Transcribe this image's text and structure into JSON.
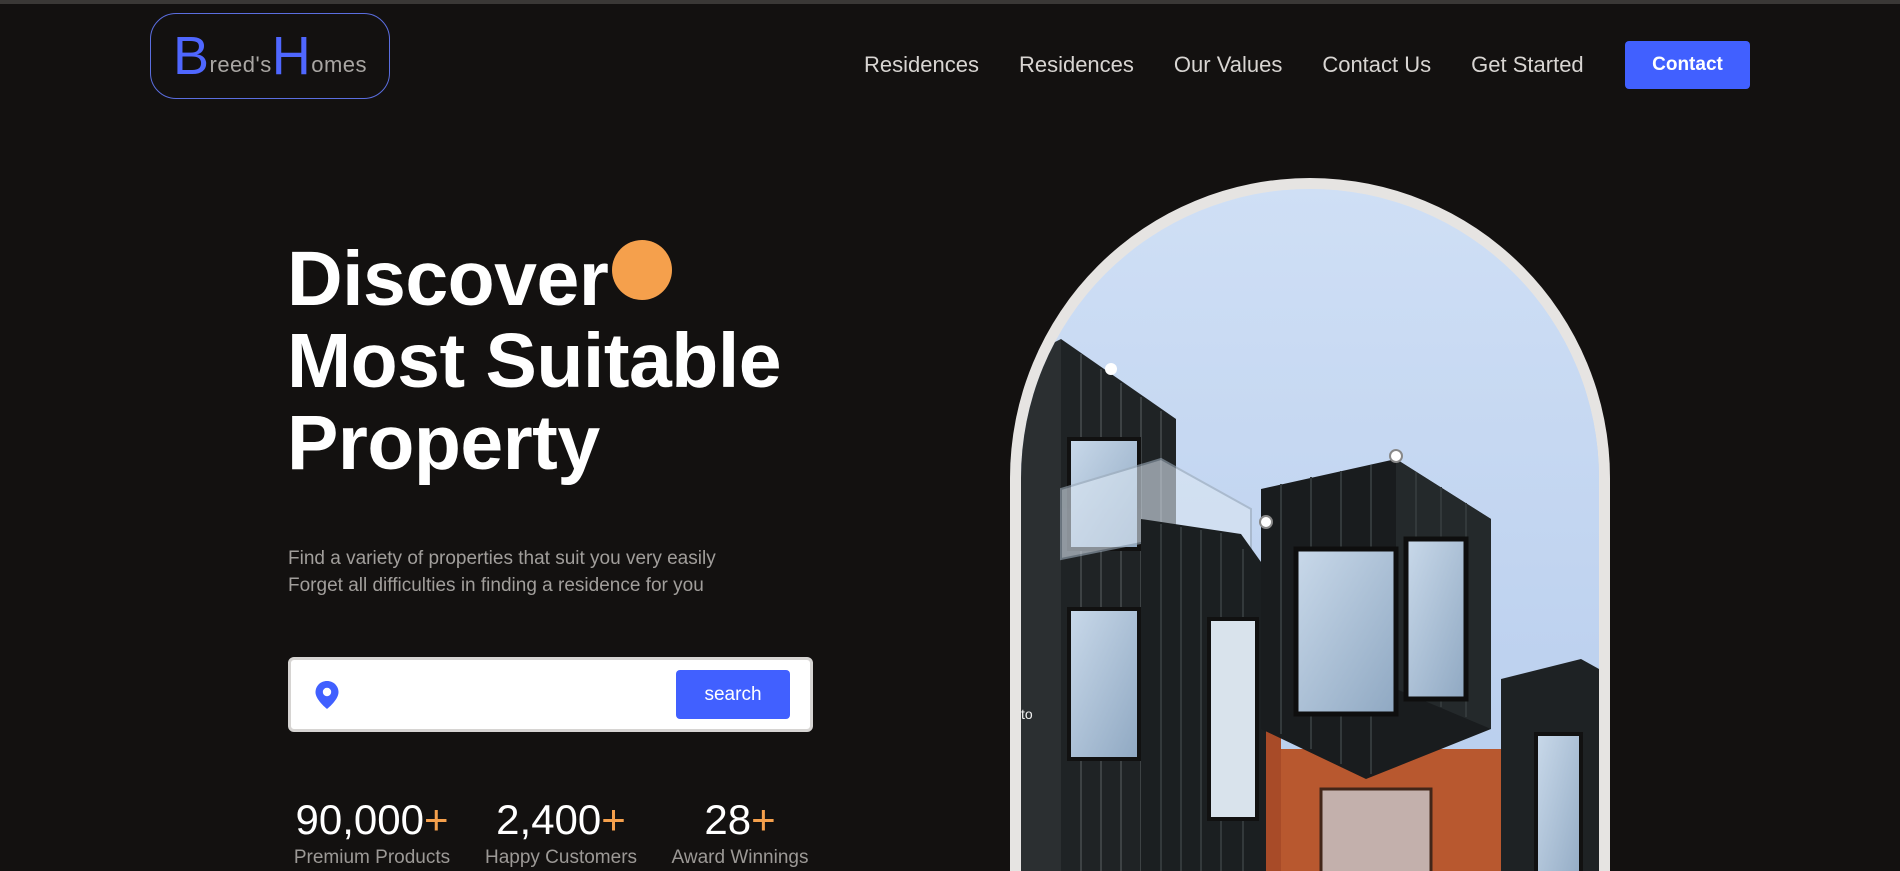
{
  "header": {
    "logo": {
      "letter1": "B",
      "rest1": "reed's ",
      "letter2": "H",
      "rest2": "omes"
    },
    "nav": [
      "Residences",
      "Residences",
      "Our Values",
      "Contact Us",
      "Get Started"
    ],
    "contact_label": "Contact"
  },
  "hero": {
    "title_lines": [
      "Discover",
      "Most Suitable",
      "Property"
    ],
    "subtitle_lines": [
      "Find a variety of properties that suit you very easily",
      "Forget all difficulties in finding a residence for you"
    ]
  },
  "search": {
    "placeholder": "",
    "value": "",
    "button_label": "search",
    "icon": "location-pin-icon"
  },
  "stats": [
    {
      "value": "90,000",
      "suffix": "+",
      "label": "Premium Products"
    },
    {
      "value": "2,400",
      "suffix": "+",
      "label": "Happy Customers"
    },
    {
      "value": "28",
      "suffix": "+",
      "label": "Award Winnings"
    }
  ],
  "image": {
    "alt_text": "to"
  },
  "colors": {
    "background": "#131110",
    "accent_blue": "#4160ff",
    "accent_orange": "#f5a04c",
    "text_muted": "#a19e9b"
  }
}
